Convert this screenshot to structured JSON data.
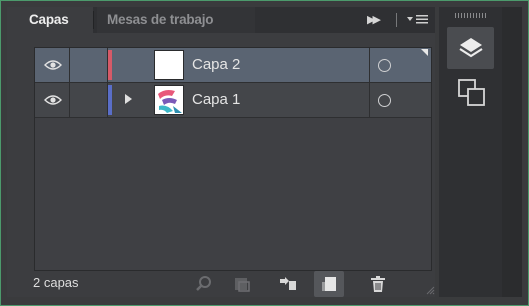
{
  "tabs": [
    {
      "label": "Capas",
      "active": true
    },
    {
      "label": "Mesas de trabajo",
      "active": false
    }
  ],
  "header_icons": [
    "fast-forward-icon",
    "panel-menu-icon"
  ],
  "layers": [
    {
      "name": "Capa 2",
      "visible": true,
      "color": "#d65a68",
      "selected": true,
      "expandable": false,
      "thumbnail": "blank-white"
    },
    {
      "name": "Capa 1",
      "visible": true,
      "color": "#5a6ec8",
      "selected": false,
      "expandable": true,
      "thumbnail": "artwork"
    }
  ],
  "footer": {
    "count_label": "2 capas",
    "icons": [
      "locate-object-icon",
      "make-clipping-mask-icon",
      "create-sublayer-icon",
      "create-new-layer-icon",
      "delete-icon"
    ]
  },
  "dock": {
    "icons": [
      "layers-panel-icon",
      "artboards-panel-icon"
    ]
  }
}
